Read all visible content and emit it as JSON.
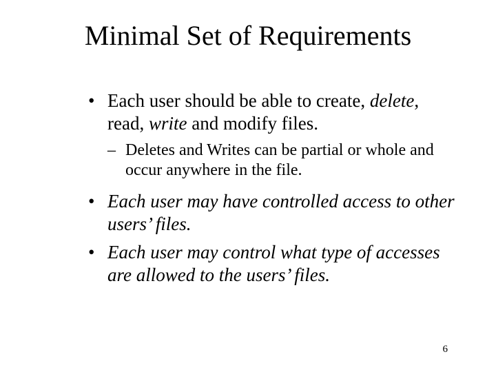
{
  "title": "Minimal Set of Requirements",
  "b1": {
    "seg1": "Each user should be able to create, ",
    "seg2_em": "delete",
    "seg3": ", read, ",
    "seg4_em": "write",
    "seg5": " and modify files."
  },
  "b1_sub": "Deletes and Writes can be partial or whole and occur anywhere in the file.",
  "b2_em": "Each user may have controlled access to other users’ files.",
  "b3_em": "Each user may control what type of accesses are allowed to the users’ files.",
  "page_number": "6"
}
